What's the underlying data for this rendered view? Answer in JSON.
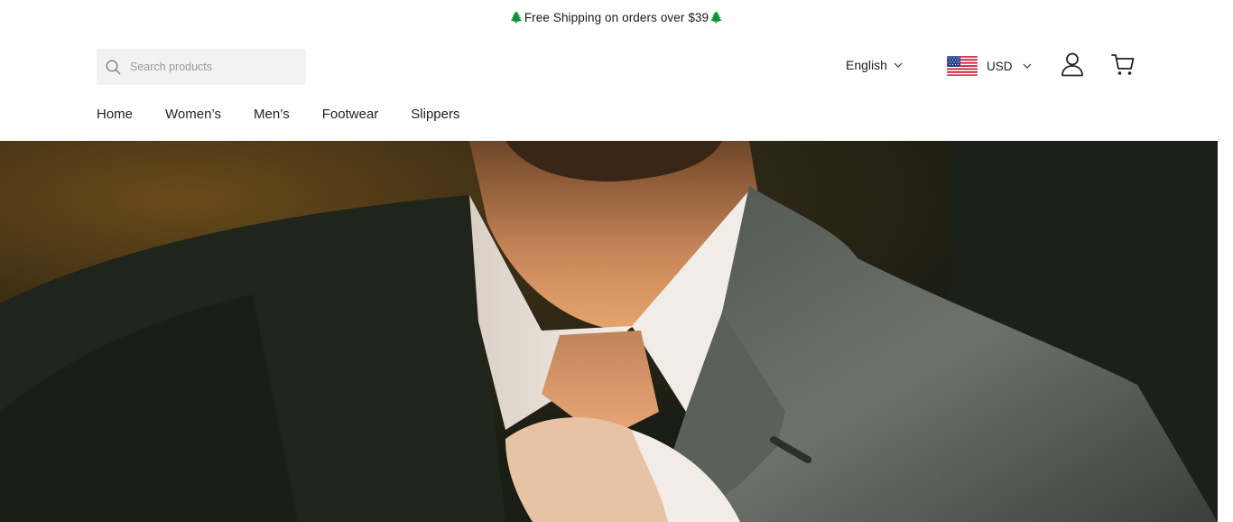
{
  "announcement": {
    "text": "Free Shipping on orders over $39",
    "decoration_icon": "pine-tree-emoji",
    "decoration_color": "#2f7d32"
  },
  "search": {
    "placeholder": "Search products",
    "icon": "search-icon"
  },
  "language": {
    "selected": "English",
    "icon": "chevron-down-icon"
  },
  "currency": {
    "selected": "USD",
    "flag": "us-flag-icon",
    "icon": "chevron-down-icon"
  },
  "header_icons": {
    "account": "user-icon",
    "cart": "shopping-cart-icon"
  },
  "nav": {
    "items": [
      {
        "label": "Home"
      },
      {
        "label": "Women’s"
      },
      {
        "label": "Men’s"
      },
      {
        "label": "Footwear"
      },
      {
        "label": "Slippers"
      }
    ]
  },
  "hero": {
    "image": "man-in-grey-suit-adjusting-tie-photo"
  },
  "colors": {
    "text": "#222222",
    "search_bg": "#f2f2f2",
    "hero_dark": "#1d2016"
  }
}
